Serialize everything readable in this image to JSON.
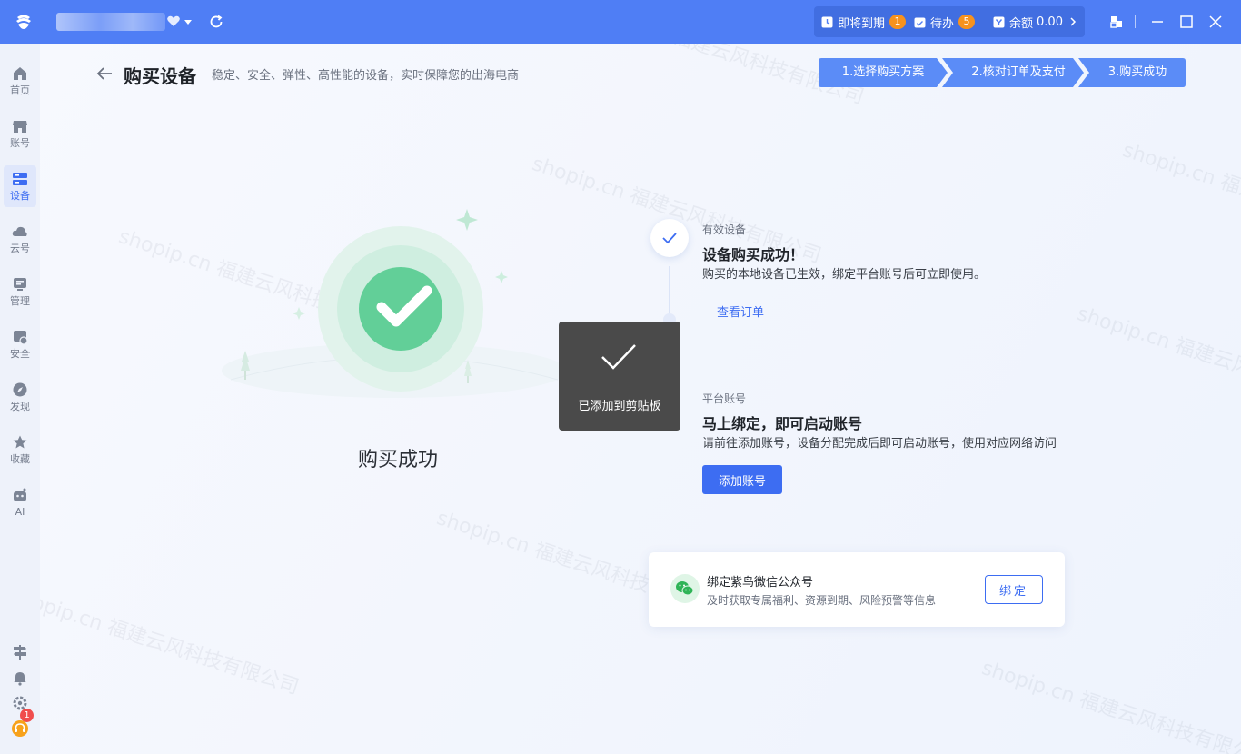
{
  "titlebar": {
    "status": {
      "expiring_label": "即将到期",
      "expiring_count": "1",
      "todo_label": "待办",
      "todo_count": "5",
      "balance_label": "余额",
      "balance_value": "0.00"
    }
  },
  "sidebar": {
    "items": [
      {
        "label": "首页",
        "icon": "home-icon"
      },
      {
        "label": "账号",
        "icon": "store-icon"
      },
      {
        "label": "设备",
        "icon": "server-icon",
        "active": true
      },
      {
        "label": "云号",
        "icon": "cloud-icon"
      },
      {
        "label": "管理",
        "icon": "manage-icon"
      },
      {
        "label": "安全",
        "icon": "shield-icon"
      },
      {
        "label": "发现",
        "icon": "compass-icon"
      },
      {
        "label": "收藏",
        "icon": "star-icon"
      },
      {
        "label": "AI",
        "icon": "robot-icon"
      }
    ],
    "notification_count": "1"
  },
  "header": {
    "title": "购买设备",
    "subtitle": "稳定、安全、弹性、高性能的设备，实时保障您的出海电商",
    "steps": [
      "1.选择购买方案",
      "2.核对订单及支付",
      "3.购买成功"
    ]
  },
  "main": {
    "success_label": "购买成功",
    "section1": {
      "small": "有效设备",
      "title": "设备购买成功！",
      "desc": "购买的本地设备已生效，绑定平台账号后可立即使用。",
      "link": "查看订单"
    },
    "section2": {
      "small": "平台账号",
      "title": "马上绑定，即可启动账号",
      "desc": "请前往添加账号，设备分配完成后即可启动账号，使用对应网络访问",
      "button": "添加账号"
    },
    "toast": "已添加到剪贴板",
    "wechat": {
      "title": "绑定紫鸟微信公众号",
      "desc": "及时获取专属福利、资源到期、风险预警等信息",
      "button": "绑定"
    }
  },
  "watermark": "shopip.cn 福建云风科技有限公司",
  "colors": {
    "primary": "#3d6df2",
    "titlebar": "#4f7ef5",
    "badge": "#f7921e",
    "success_green": "#43c38a"
  }
}
